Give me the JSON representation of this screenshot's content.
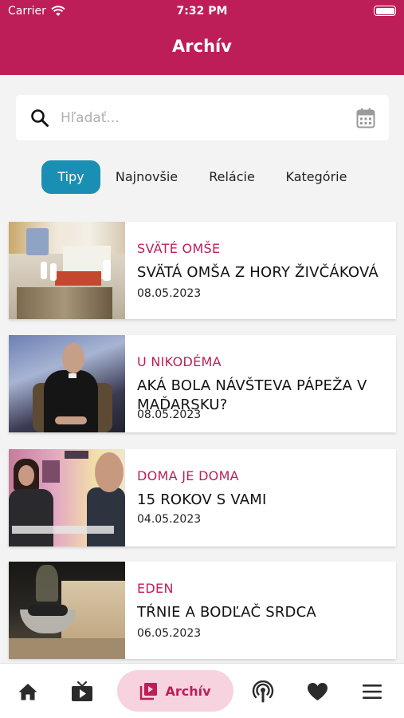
{
  "status_bar": {
    "carrier": "Carrier",
    "time": "7:32 PM"
  },
  "header": {
    "title": "Archív"
  },
  "search": {
    "placeholder": "Hľadať..."
  },
  "tabs": [
    {
      "label": "Tipy",
      "active": true
    },
    {
      "label": "Najnovšie",
      "active": false
    },
    {
      "label": "Relácie",
      "active": false
    },
    {
      "label": "Kategórie",
      "active": false
    }
  ],
  "items": [
    {
      "category": "SVÄTÉ OMŠE",
      "title": "SVÄTÁ OMŠA Z HORY ŽIVČÁKOVÁ",
      "date": "08.05.2023"
    },
    {
      "category": "U NIKODÉMA",
      "title": "AKÁ BOLA NÁVŠTEVA PÁPEŽA V MAĎARSKU?",
      "date": "08.05.2023"
    },
    {
      "category": "DOMA JE DOMA",
      "title": "15 ROKOV S VAMI",
      "date": "04.05.2023"
    },
    {
      "category": "EDEN",
      "title": "TŔNIE A BODĽAČ SRDCA",
      "date": "06.05.2023"
    }
  ],
  "bottom_nav": {
    "archive_label": "Archív"
  },
  "colors": {
    "brand": "#be1e58",
    "active_tab": "#1a8fb3",
    "nav_pill": "#f6d3df"
  }
}
